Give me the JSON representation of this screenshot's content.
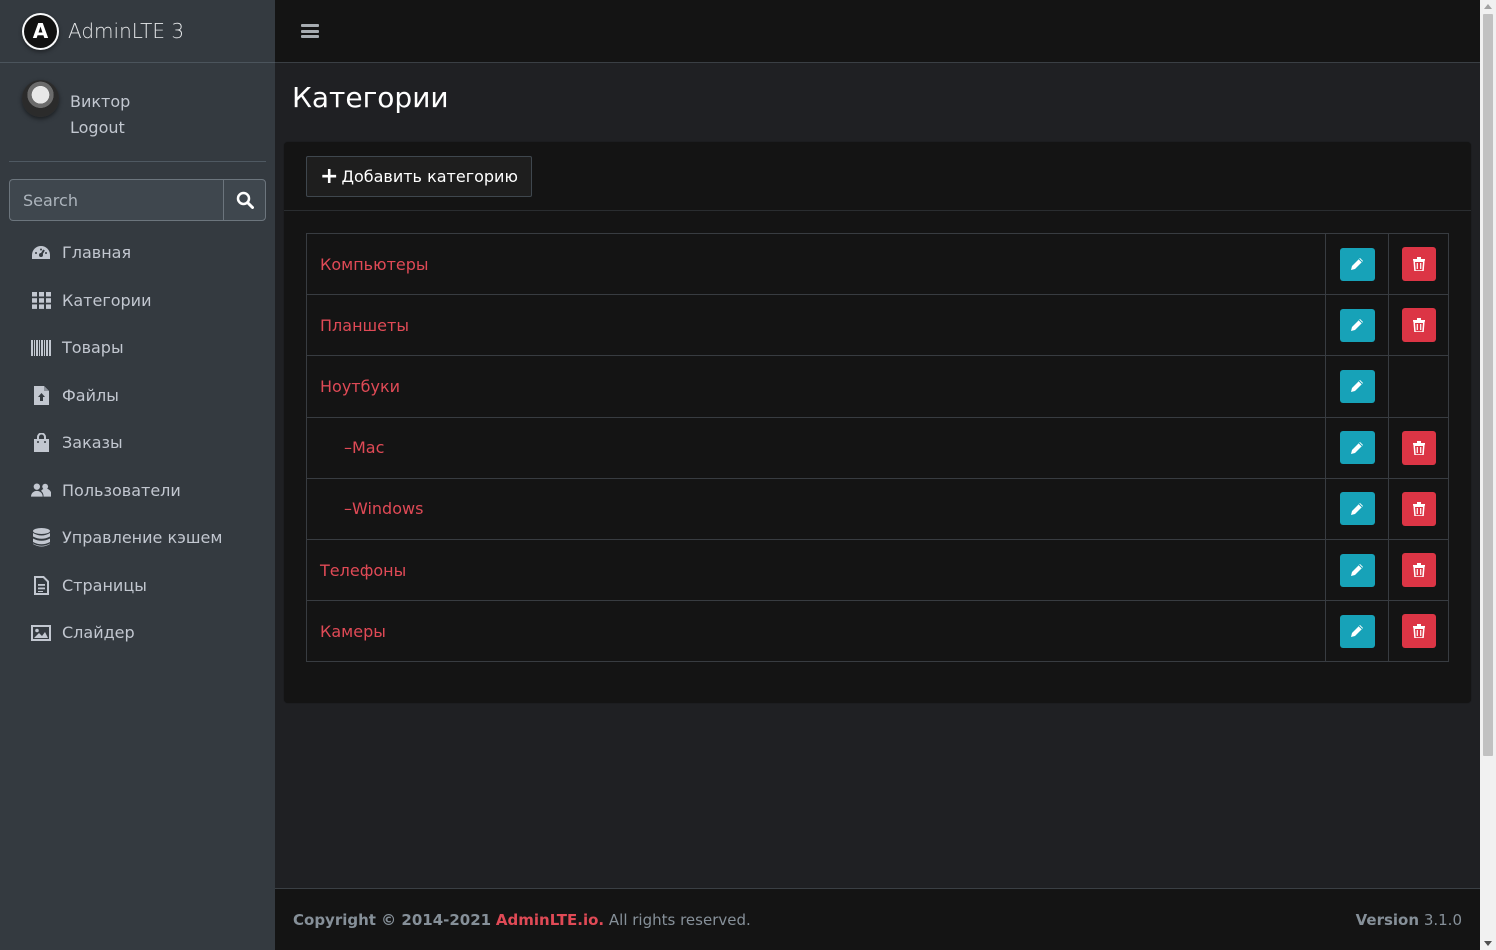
{
  "brand": {
    "logo_letter": "A",
    "title": "AdminLTE 3"
  },
  "user": {
    "name": "Виктор",
    "logout_label": "Logout"
  },
  "search": {
    "placeholder": "Search"
  },
  "nav": [
    {
      "label": "Главная",
      "icon": "tachometer-icon"
    },
    {
      "label": "Категории",
      "icon": "grid-icon"
    },
    {
      "label": "Товары",
      "icon": "barcode-icon"
    },
    {
      "label": "Файлы",
      "icon": "file-upload-icon"
    },
    {
      "label": "Заказы",
      "icon": "shopping-bag-icon"
    },
    {
      "label": "Пользователи",
      "icon": "users-icon"
    },
    {
      "label": "Управление кэшем",
      "icon": "database-icon"
    },
    {
      "label": "Страницы",
      "icon": "file-text-icon"
    },
    {
      "label": "Слайдер",
      "icon": "image-icon"
    }
  ],
  "page": {
    "title": "Категории",
    "add_button_label": "Добавить категорию"
  },
  "categories": [
    {
      "name": "Компьютеры",
      "child": false,
      "deletable": true
    },
    {
      "name": "Планшеты",
      "child": false,
      "deletable": true
    },
    {
      "name": "Ноутбуки",
      "child": false,
      "deletable": false
    },
    {
      "name": "–Mac",
      "child": true,
      "deletable": true
    },
    {
      "name": "–Windows",
      "child": true,
      "deletable": true
    },
    {
      "name": "Телефоны",
      "child": false,
      "deletable": true
    },
    {
      "name": "Камеры",
      "child": false,
      "deletable": true
    }
  ],
  "footer": {
    "copyright_prefix": "Copyright © 2014-2021",
    "link_text": "AdminLTE.io.",
    "suffix": "All rights reserved.",
    "version_label": "Version",
    "version_value": "3.1.0"
  },
  "colors": {
    "accent": "#e04a56",
    "edit": "#17a2b8",
    "delete": "#dc3545",
    "sidebar": "#343a40"
  }
}
